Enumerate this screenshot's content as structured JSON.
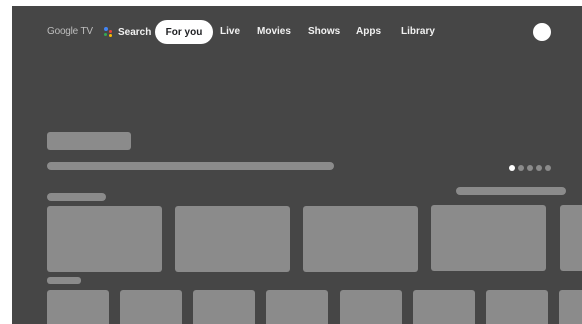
{
  "brand": "Google TV",
  "nav": {
    "search_label": "Search",
    "selected": "For you",
    "items": [
      "Live",
      "Movies",
      "Shows",
      "Apps",
      "Library"
    ]
  },
  "carousel": {
    "page_count": 5,
    "active_index": 0
  },
  "colors": {
    "background": "#464646",
    "placeholder": "#8b8b8b",
    "pill": "#ffffff",
    "mic_blue": "#4285f4",
    "mic_red": "#ea4335",
    "mic_yellow": "#fbbc04",
    "mic_green": "#34a853"
  },
  "icons": {
    "search": "mic-icon",
    "profile": "avatar"
  }
}
